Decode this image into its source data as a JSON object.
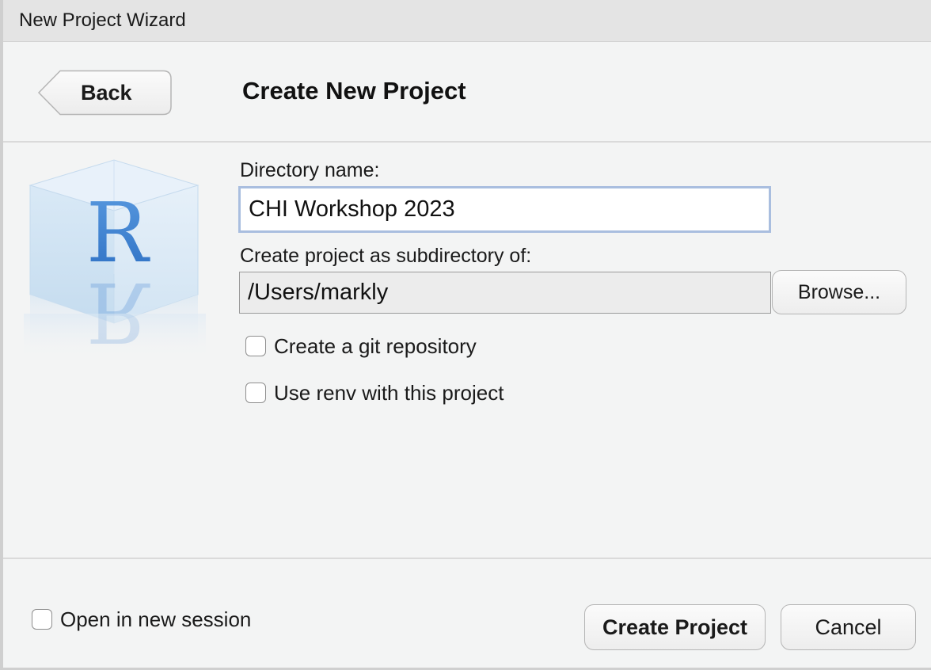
{
  "window": {
    "title": "New Project Wizard"
  },
  "header": {
    "back_label": "Back",
    "page_title": "Create New Project"
  },
  "logo": {
    "icon": "r-logo-icon",
    "letter": "R"
  },
  "form": {
    "directory_label": "Directory name:",
    "directory_value": "CHI Workshop 2023",
    "subdirectory_label": "Create project as subdirectory of:",
    "subdirectory_value": "/Users/markly",
    "browse_label": "Browse...",
    "git_label": "Create a git repository",
    "git_checked": false,
    "renv_label": "Use renv with this project",
    "renv_checked": false
  },
  "footer": {
    "open_new_session_label": "Open in new session",
    "open_new_session_checked": false,
    "create_label": "Create Project",
    "cancel_label": "Cancel"
  },
  "colors": {
    "window_bg": "#f3f4f4",
    "titlebar_bg": "#e4e4e4",
    "focus_border": "#a9bedf",
    "r_blue": "#3b7fd1"
  }
}
